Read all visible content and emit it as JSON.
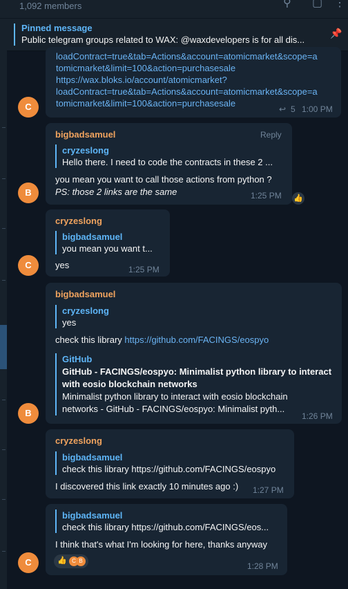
{
  "header": {
    "members": "1,092 members",
    "icons": [
      "search-icon",
      "sidebar-icon",
      "more-icon"
    ]
  },
  "pinned": {
    "title": "Pinned message",
    "text": "Public telegram groups related to WAX:  @waxdevelopers is for all dis...",
    "icon": "pin-icon"
  },
  "messages": [
    {
      "lines": [
        "loadContract=true&tab=Actions&account=atomicmarket&scope=a",
        "tomicmarket&limit=100&action=purchasesale",
        "https://wax.bloks.io/account/atomicmarket?",
        "loadContract=true&tab=Actions&account=atomicmarket&scope=a",
        "tomicmarket&limit=100&action=purchasesale"
      ],
      "replies_count": "5",
      "time": "1:00 PM",
      "avatar": "C"
    },
    {
      "sender": "bigbadsamuel",
      "reply_label": "Reply",
      "quote_name": "cryzeslong",
      "quote_text": "Hello there. I need to code the contracts in these 2 ...",
      "text": "you mean you want to call those actions from python ?",
      "text2": "PS: those 2 links are the same",
      "time": "1:25 PM",
      "avatar": "B",
      "reaction": "👍"
    },
    {
      "sender": "cryzeslong",
      "quote_name": "bigbadsamuel",
      "quote_text": "you mean you want t...",
      "text": "yes",
      "time": "1:25 PM",
      "avatar": "C"
    },
    {
      "sender": "bigbadsamuel",
      "quote_name": "cryzeslong",
      "quote_text": "yes",
      "text_prefix": "check this library ",
      "link": "https://github.com/FACINGS/eospyo",
      "preview_site": "GitHub",
      "preview_title_1": "GitHub - FACINGS/eospyo: Minimalist python library to interact",
      "preview_title_2": "with eosio blockchain networks",
      "preview_desc_1": "Minimalist python library to interact with eosio blockchain",
      "preview_desc_2": "networks - GitHub - FACINGS/eospyo: Minimalist pyth...",
      "time": "1:26 PM",
      "avatar": "B"
    },
    {
      "sender": "cryzeslong",
      "quote_name": "bigbadsamuel",
      "quote_text": "check this library https://github.com/FACINGS/eospyo",
      "text": "I discovered this link exactly 10 minutes ago :)",
      "time": "1:27 PM"
    },
    {
      "quote_name": "bigbadsamuel",
      "quote_text": "check this library https://github.com/FACINGS/eos...",
      "text": "I think that's what I'm looking for here, thanks anyway",
      "reaction": "👍",
      "reactor_avatars": [
        "C",
        "B"
      ],
      "time": "1:28 PM",
      "avatar": "C"
    }
  ]
}
